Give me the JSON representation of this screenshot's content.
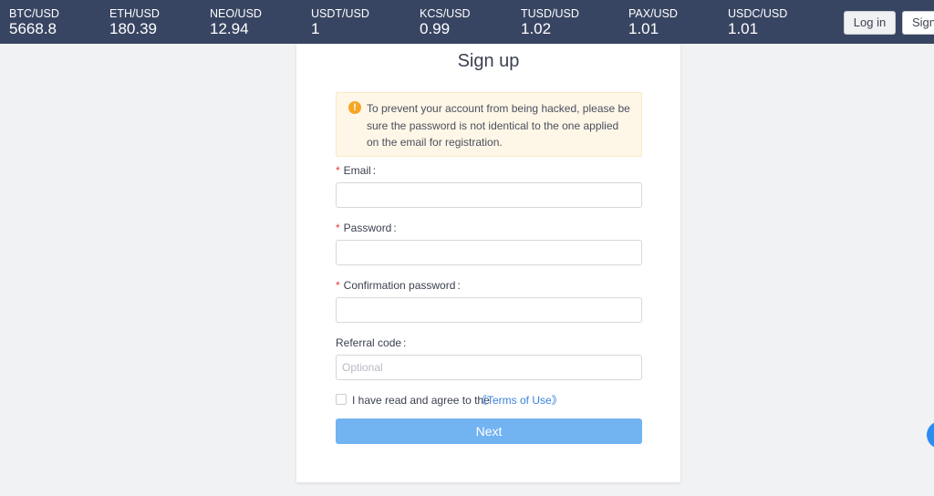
{
  "tickers": [
    {
      "pair": "BTC/USD",
      "price": "5668.8"
    },
    {
      "pair": "ETH/USD",
      "price": "180.39"
    },
    {
      "pair": "NEO/USD",
      "price": "12.94"
    },
    {
      "pair": "USDT/USD",
      "price": "1"
    },
    {
      "pair": "KCS/USD",
      "price": "0.99"
    },
    {
      "pair": "TUSD/USD",
      "price": "1.02"
    },
    {
      "pair": "PAX/USD",
      "price": "1.01"
    },
    {
      "pair": "USDC/USD",
      "price": "1.01"
    }
  ],
  "header": {
    "login_label": "Log in",
    "signup_label": "Sign"
  },
  "form": {
    "title": "Sign up",
    "notice_icon": "!",
    "notice": "To prevent your account from being hacked, please be sure the password is not identical to the one applied on the email for registration.",
    "required_mark": "*",
    "colon": ":",
    "email_label": "Email",
    "email_value": "",
    "password_label": "Password",
    "password_value": "",
    "confirm_label": "Confirmation password",
    "confirm_value": "",
    "referral_label": "Referral code",
    "referral_placeholder": "Optional",
    "agree_text": "I have read and agree to the",
    "terms_link": "《Terms of Use》",
    "next_label": "Next"
  },
  "colors": {
    "topbar": "#384562",
    "accent": "#72b3f2",
    "link": "#3a82dd",
    "required": "#e4393c",
    "warning": "#f5a623"
  },
  "icons": {
    "notice": "warning-icon",
    "floating": "chat-bubble-icon"
  }
}
